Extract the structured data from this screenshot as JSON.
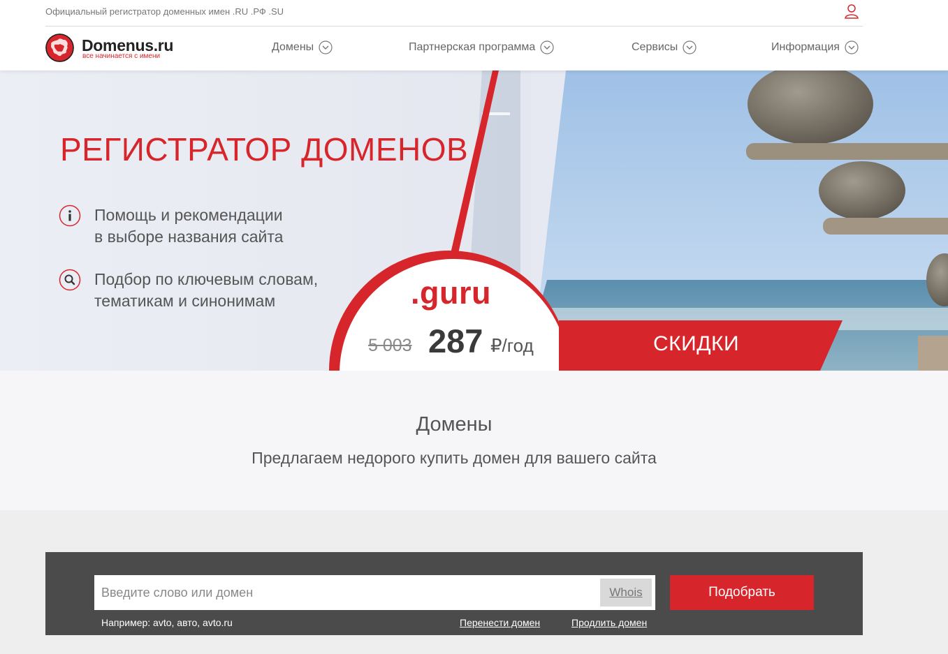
{
  "header": {
    "tagline": "Официальный регистратор доменных имен .RU .РФ .SU",
    "logo": {
      "name": "Domenus.ru",
      "slogan": "все начинается с имени"
    },
    "nav": [
      {
        "label": "Домены"
      },
      {
        "label": "Партнерская программа"
      },
      {
        "label": "Сервисы"
      },
      {
        "label": "Информация"
      }
    ],
    "icons": {
      "user": "user-icon",
      "chevron": "chevron-down-icon"
    }
  },
  "hero": {
    "title": "РЕГИСТРАТОР ДОМЕНОВ",
    "features": [
      {
        "icon": "info-icon",
        "line1": "Помощь и рекомендации",
        "line2": "в выборе названия сайта"
      },
      {
        "icon": "search-icon",
        "line1": "Подбор по ключевым словам,",
        "line2": "тематикам и синонимам"
      }
    ],
    "promo": {
      "zone": ".guru",
      "old_price": "5 003",
      "new_price": "287",
      "currency": "₽",
      "period": "/год"
    },
    "sale_button": "СКИДКИ"
  },
  "domains_section": {
    "title": "Домены",
    "subtitle": "Предлагаем недорого купить домен для вашего сайта"
  },
  "search": {
    "placeholder": "Введите слово или домен",
    "value": "",
    "whois_label": "Whois",
    "submit_label": "Подобрать",
    "example": "Например: avto, авто, avto.ru",
    "transfer_link": "Перенести домен",
    "renew_link": "Продлить домен"
  },
  "colors": {
    "accent": "#d7262b",
    "dark_panel": "#4b4b4b",
    "text": "#555555"
  }
}
